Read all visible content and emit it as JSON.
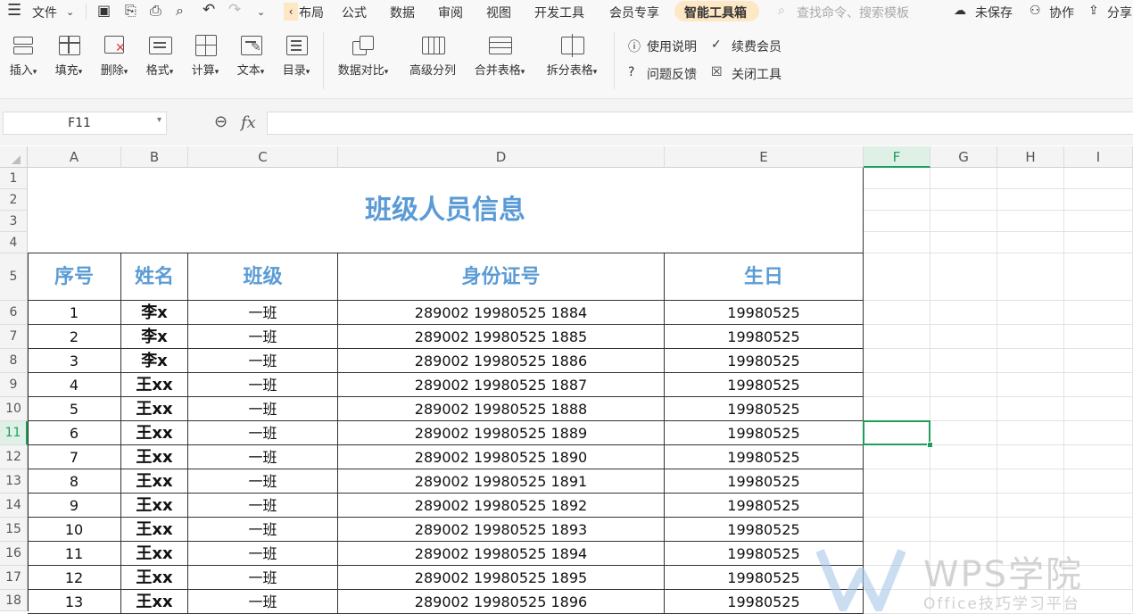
{
  "menubar": {
    "file": "文件",
    "tabs": [
      "布局",
      "公式",
      "数据",
      "审阅",
      "视图",
      "开发工具",
      "会员专享",
      "智能工具箱"
    ],
    "search_placeholder": "查找命令、搜索模板",
    "unsaved": "未保存",
    "collab": "协作",
    "share": "分享"
  },
  "ribbon": {
    "insert": "插入",
    "fill": "填充",
    "delete": "删除",
    "format": "格式",
    "calc": "计算",
    "text": "文本",
    "toc": "目录",
    "compare": "数据对比",
    "split_adv": "高级分列",
    "merge_tables": "合并表格",
    "split_tables": "拆分表格",
    "help": "使用说明",
    "renew": "续费会员",
    "feedback": "问题反馈",
    "close_tool": "关闭工具"
  },
  "formula_bar": {
    "cell_ref": "F11",
    "fx": "fx",
    "value": ""
  },
  "columns": [
    "A",
    "B",
    "C",
    "D",
    "E",
    "F",
    "G",
    "H",
    "I"
  ],
  "rows": [
    "1",
    "2",
    "3",
    "4",
    "5",
    "6",
    "7",
    "8",
    "9",
    "10",
    "11",
    "12",
    "13",
    "14",
    "15",
    "16",
    "17",
    "18"
  ],
  "sheet": {
    "title": "班级人员信息",
    "headers": [
      "序号",
      "姓名",
      "班级",
      "身份证号",
      "生日"
    ],
    "data": [
      [
        "1",
        "李x",
        "一班",
        "289002 19980525 1884",
        "19980525"
      ],
      [
        "2",
        "李x",
        "一班",
        "289002 19980525 1885",
        "19980525"
      ],
      [
        "3",
        "李x",
        "一班",
        "289002 19980525 1886",
        "19980525"
      ],
      [
        "4",
        "王xx",
        "一班",
        "289002 19980525 1887",
        "19980525"
      ],
      [
        "5",
        "王xx",
        "一班",
        "289002 19980525 1888",
        "19980525"
      ],
      [
        "6",
        "王xx",
        "一班",
        "289002 19980525 1889",
        "19980525"
      ],
      [
        "7",
        "王xx",
        "一班",
        "289002 19980525 1890",
        "19980525"
      ],
      [
        "8",
        "王xx",
        "一班",
        "289002 19980525 1891",
        "19980525"
      ],
      [
        "9",
        "王xx",
        "一班",
        "289002 19980525 1892",
        "19980525"
      ],
      [
        "10",
        "王xx",
        "一班",
        "289002 19980525 1893",
        "19980525"
      ],
      [
        "11",
        "王xx",
        "一班",
        "289002 19980525 1894",
        "19980525"
      ],
      [
        "12",
        "王xx",
        "一班",
        "289002 19980525 1895",
        "19980525"
      ],
      [
        "13",
        "王xx",
        "一班",
        "289002 19980525 1896",
        "19980525"
      ]
    ]
  },
  "watermark": {
    "brand": "WPS学院",
    "tagline": "Office技巧学习平台"
  },
  "colors": {
    "accent_blue": "#5b9bd5",
    "selection_green": "#1e9e5a",
    "active_tab": "#fde7c4"
  }
}
